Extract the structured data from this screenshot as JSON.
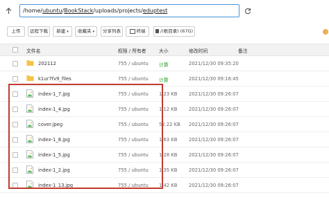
{
  "path_bar": {
    "segments": [
      "/home/",
      "ubuntu",
      "/",
      "BookStack",
      "/uploads/projects/",
      "eduptest"
    ]
  },
  "toolbar": {
    "upload": "上传",
    "remote_download": "远程下载",
    "new": "新建",
    "favorites": "收藏夹",
    "share_list": "分享列表",
    "terminal": "终端",
    "disk": "/(根目录) (67G)"
  },
  "table": {
    "headers": {
      "name": "文件名",
      "perm": "权限 / 所有者",
      "size": "大小",
      "mtime": "修改时间",
      "note": "备注"
    },
    "rows": [
      {
        "name": "202112",
        "type": "folder",
        "perm": "755 / ubuntu",
        "size": "计算",
        "mtime": "2021/12/30 09:35:20"
      },
      {
        "name": "k1ur7fv9_files",
        "type": "folder",
        "perm": "755 / ubuntu",
        "size": "计算",
        "mtime": "2021/12/30 09:16:45"
      },
      {
        "name": "index-1_7.jpg",
        "type": "image",
        "perm": "755 / ubuntu",
        "size": "1.23 KB",
        "mtime": "2021/12/30 09:26:07"
      },
      {
        "name": "index-1_4.jpg",
        "type": "image",
        "perm": "755 / ubuntu",
        "size": "1.12 KB",
        "mtime": "2021/12/30 09:26:07"
      },
      {
        "name": "cover.jpeg",
        "type": "image",
        "perm": "755 / ubuntu",
        "size": "52.22 KB",
        "mtime": "2021/12/30 09:26:07"
      },
      {
        "name": "index-1_8.jpg",
        "type": "image",
        "perm": "755 / ubuntu",
        "size": "1.63 KB",
        "mtime": "2021/12/30 09:26:07"
      },
      {
        "name": "index-1_5.jpg",
        "type": "image",
        "perm": "755 / ubuntu",
        "size": "1.28 KB",
        "mtime": "2021/12/30 09:26:07"
      },
      {
        "name": "index-1_2.jpg",
        "type": "image",
        "perm": "755 / ubuntu",
        "size": "1.35 KB",
        "mtime": "2021/12/30 09:26:07"
      },
      {
        "name": "index-1_13.jpg",
        "type": "image",
        "perm": "755 / ubuntu",
        "size": "1.42 KB",
        "mtime": "2021/12/30 09:26:07"
      }
    ]
  },
  "colors": {
    "accent": "#4a90d9",
    "folder": "#f5c345",
    "compute_link": "#2aa02a",
    "highlight_frame": "#c0392b"
  }
}
